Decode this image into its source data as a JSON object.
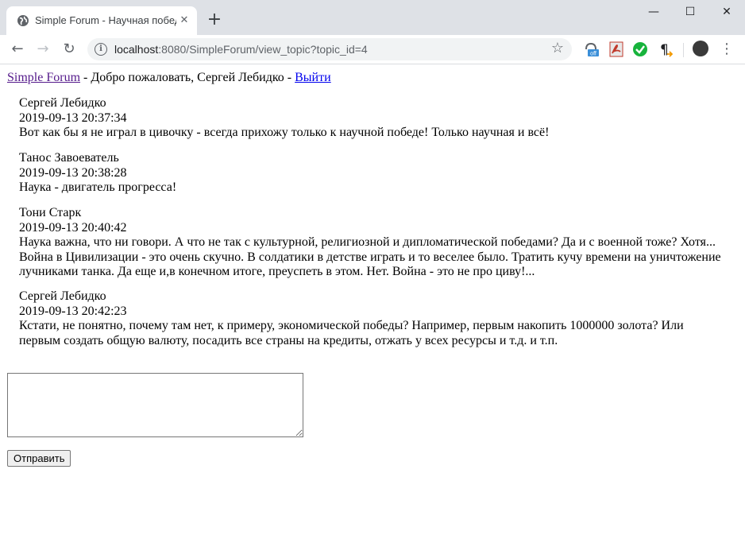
{
  "browser": {
    "tab_title": "Simple Forum - Научная победа",
    "url_host": "localhost",
    "url_rest": ":8080/SimpleForum/view_topic?topic_id=4",
    "ext_off_badge": "off"
  },
  "forum": {
    "site_link": "Simple Forum",
    "welcome_text": " - Добро пожаловать, Сергей Лебидко - ",
    "logout_link": "Выйти",
    "posts": [
      {
        "author": "Сергей Лебидко",
        "date": "2019-09-13 20:37:34",
        "text": "Вот как бы я не играл в цивочку - всегда прихожу только к научной победе! Только научная и всё!"
      },
      {
        "author": "Танос Завоеватель",
        "date": "2019-09-13 20:38:28",
        "text": "Наука - двигатель прогресса!"
      },
      {
        "author": "Тони Старк",
        "date": "2019-09-13 20:40:42",
        "text": "Наука важна, что ни говори. А что не так с культурной, религиозной и дипломатической победами? Да и с военной тоже? Хотя... Война в Цивилизации - это очень скучно. В солдатики в детстве играть и то веселее было. Тратить кучу времени на уничтожение лучниками танка. Да еще и,в конечном итоге, преуспеть в этом. Нет. Война - это не про циву!..."
      },
      {
        "author": "Сергей Лебидко",
        "date": "2019-09-13 20:42:23",
        "text": "Кстати, не понятно, почему там нет, к примеру, экономической победы? Например, первым накопить 1000000 золота? Или первым создать общую валюту, посадить все страны на кредиты, отжать у всех ресурсы и т.д. и т.п."
      }
    ],
    "reply_value": "",
    "submit_label": "Отправить"
  }
}
